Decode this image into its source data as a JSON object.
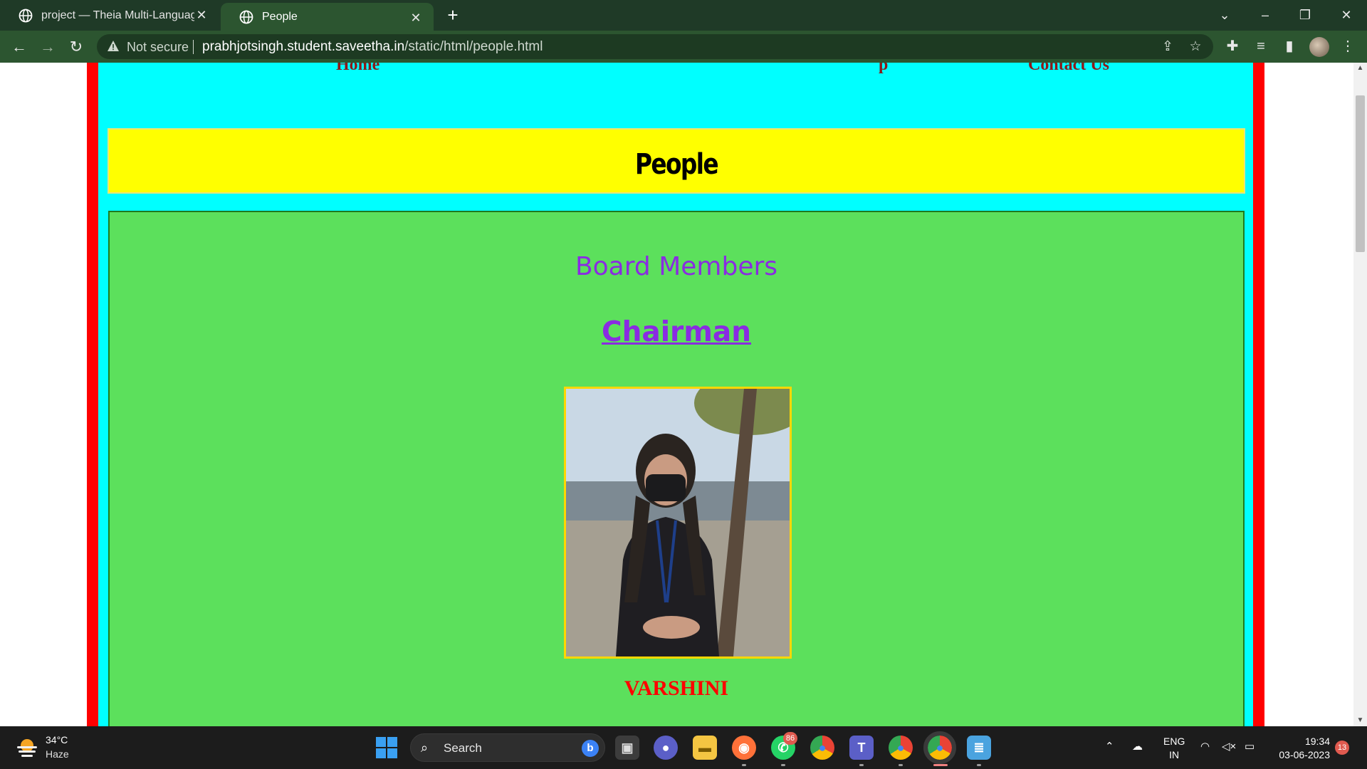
{
  "browser": {
    "tabs": [
      {
        "title": "project — Theia Multi-Language",
        "active": false
      },
      {
        "title": "People",
        "active": true
      }
    ],
    "security_label": "Not secure",
    "url_host": "prabhjotsingh.student.saveetha.in",
    "url_path": "/static/html/people.html"
  },
  "page": {
    "nav": {
      "left_link": "Home",
      "right_partial": "p",
      "contact": "Contact Us"
    },
    "header_title": "People",
    "section_title": "Board Members",
    "role": "Chairman",
    "member_name": "VARSHINI",
    "colors": {
      "frame": "#ff0000",
      "background": "#00ffff",
      "header": "#ffff00",
      "content": "#5ce05c",
      "heading_text": "#8a2be2",
      "name_text": "#ff0000",
      "photo_border": "#ffd700"
    }
  },
  "taskbar": {
    "weather": {
      "temp": "34°C",
      "condition": "Haze"
    },
    "search_label": "Search",
    "whatsapp_badge": "86",
    "lang_top": "ENG",
    "lang_bottom": "IN",
    "time": "19:34",
    "date": "03-06-2023",
    "notifications": "13"
  }
}
